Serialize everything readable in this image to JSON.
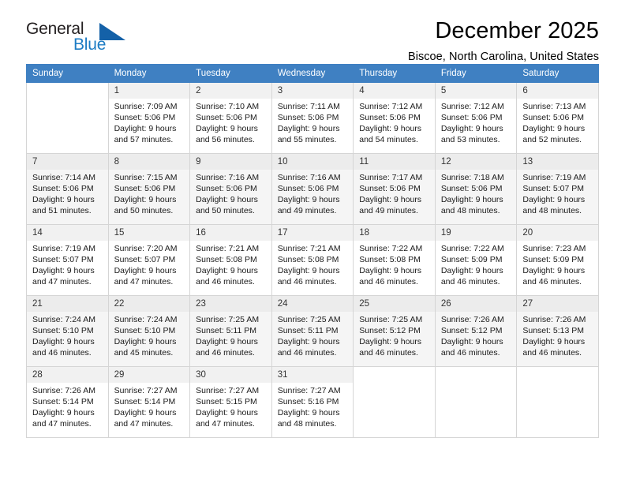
{
  "brand": {
    "name_part1": "General",
    "name_part2": "Blue",
    "triangle_color": "#1461a8",
    "blue_color": "#1d7cc4"
  },
  "header": {
    "title": "December 2025",
    "location": "Biscoe, North Carolina, United States"
  },
  "theme": {
    "header_row_bg": "#3f80c2",
    "header_row_text": "#ffffff",
    "grid_border": "#d5d5d5",
    "shaded_row_bg": "#f5f5f5",
    "daynum_bg": "#f1f1f1"
  },
  "weekdays": [
    "Sunday",
    "Monday",
    "Tuesday",
    "Wednesday",
    "Thursday",
    "Friday",
    "Saturday"
  ],
  "labels": {
    "sunrise_prefix": "Sunrise:",
    "sunset_prefix": "Sunset:",
    "daylight_prefix": "Daylight:"
  },
  "weeks": [
    {
      "shaded": false,
      "days": [
        {
          "num": "",
          "lines": []
        },
        {
          "num": "1",
          "lines": [
            "Sunrise: 7:09 AM",
            "Sunset: 5:06 PM",
            "Daylight: 9 hours",
            "and 57 minutes."
          ]
        },
        {
          "num": "2",
          "lines": [
            "Sunrise: 7:10 AM",
            "Sunset: 5:06 PM",
            "Daylight: 9 hours",
            "and 56 minutes."
          ]
        },
        {
          "num": "3",
          "lines": [
            "Sunrise: 7:11 AM",
            "Sunset: 5:06 PM",
            "Daylight: 9 hours",
            "and 55 minutes."
          ]
        },
        {
          "num": "4",
          "lines": [
            "Sunrise: 7:12 AM",
            "Sunset: 5:06 PM",
            "Daylight: 9 hours",
            "and 54 minutes."
          ]
        },
        {
          "num": "5",
          "lines": [
            "Sunrise: 7:12 AM",
            "Sunset: 5:06 PM",
            "Daylight: 9 hours",
            "and 53 minutes."
          ]
        },
        {
          "num": "6",
          "lines": [
            "Sunrise: 7:13 AM",
            "Sunset: 5:06 PM",
            "Daylight: 9 hours",
            "and 52 minutes."
          ]
        }
      ]
    },
    {
      "shaded": true,
      "days": [
        {
          "num": "7",
          "lines": [
            "Sunrise: 7:14 AM",
            "Sunset: 5:06 PM",
            "Daylight: 9 hours",
            "and 51 minutes."
          ]
        },
        {
          "num": "8",
          "lines": [
            "Sunrise: 7:15 AM",
            "Sunset: 5:06 PM",
            "Daylight: 9 hours",
            "and 50 minutes."
          ]
        },
        {
          "num": "9",
          "lines": [
            "Sunrise: 7:16 AM",
            "Sunset: 5:06 PM",
            "Daylight: 9 hours",
            "and 50 minutes."
          ]
        },
        {
          "num": "10",
          "lines": [
            "Sunrise: 7:16 AM",
            "Sunset: 5:06 PM",
            "Daylight: 9 hours",
            "and 49 minutes."
          ]
        },
        {
          "num": "11",
          "lines": [
            "Sunrise: 7:17 AM",
            "Sunset: 5:06 PM",
            "Daylight: 9 hours",
            "and 49 minutes."
          ]
        },
        {
          "num": "12",
          "lines": [
            "Sunrise: 7:18 AM",
            "Sunset: 5:06 PM",
            "Daylight: 9 hours",
            "and 48 minutes."
          ]
        },
        {
          "num": "13",
          "lines": [
            "Sunrise: 7:19 AM",
            "Sunset: 5:07 PM",
            "Daylight: 9 hours",
            "and 48 minutes."
          ]
        }
      ]
    },
    {
      "shaded": false,
      "days": [
        {
          "num": "14",
          "lines": [
            "Sunrise: 7:19 AM",
            "Sunset: 5:07 PM",
            "Daylight: 9 hours",
            "and 47 minutes."
          ]
        },
        {
          "num": "15",
          "lines": [
            "Sunrise: 7:20 AM",
            "Sunset: 5:07 PM",
            "Daylight: 9 hours",
            "and 47 minutes."
          ]
        },
        {
          "num": "16",
          "lines": [
            "Sunrise: 7:21 AM",
            "Sunset: 5:08 PM",
            "Daylight: 9 hours",
            "and 46 minutes."
          ]
        },
        {
          "num": "17",
          "lines": [
            "Sunrise: 7:21 AM",
            "Sunset: 5:08 PM",
            "Daylight: 9 hours",
            "and 46 minutes."
          ]
        },
        {
          "num": "18",
          "lines": [
            "Sunrise: 7:22 AM",
            "Sunset: 5:08 PM",
            "Daylight: 9 hours",
            "and 46 minutes."
          ]
        },
        {
          "num": "19",
          "lines": [
            "Sunrise: 7:22 AM",
            "Sunset: 5:09 PM",
            "Daylight: 9 hours",
            "and 46 minutes."
          ]
        },
        {
          "num": "20",
          "lines": [
            "Sunrise: 7:23 AM",
            "Sunset: 5:09 PM",
            "Daylight: 9 hours",
            "and 46 minutes."
          ]
        }
      ]
    },
    {
      "shaded": true,
      "days": [
        {
          "num": "21",
          "lines": [
            "Sunrise: 7:24 AM",
            "Sunset: 5:10 PM",
            "Daylight: 9 hours",
            "and 46 minutes."
          ]
        },
        {
          "num": "22",
          "lines": [
            "Sunrise: 7:24 AM",
            "Sunset: 5:10 PM",
            "Daylight: 9 hours",
            "and 45 minutes."
          ]
        },
        {
          "num": "23",
          "lines": [
            "Sunrise: 7:25 AM",
            "Sunset: 5:11 PM",
            "Daylight: 9 hours",
            "and 46 minutes."
          ]
        },
        {
          "num": "24",
          "lines": [
            "Sunrise: 7:25 AM",
            "Sunset: 5:11 PM",
            "Daylight: 9 hours",
            "and 46 minutes."
          ]
        },
        {
          "num": "25",
          "lines": [
            "Sunrise: 7:25 AM",
            "Sunset: 5:12 PM",
            "Daylight: 9 hours",
            "and 46 minutes."
          ]
        },
        {
          "num": "26",
          "lines": [
            "Sunrise: 7:26 AM",
            "Sunset: 5:12 PM",
            "Daylight: 9 hours",
            "and 46 minutes."
          ]
        },
        {
          "num": "27",
          "lines": [
            "Sunrise: 7:26 AM",
            "Sunset: 5:13 PM",
            "Daylight: 9 hours",
            "and 46 minutes."
          ]
        }
      ]
    },
    {
      "shaded": false,
      "days": [
        {
          "num": "28",
          "lines": [
            "Sunrise: 7:26 AM",
            "Sunset: 5:14 PM",
            "Daylight: 9 hours",
            "and 47 minutes."
          ]
        },
        {
          "num": "29",
          "lines": [
            "Sunrise: 7:27 AM",
            "Sunset: 5:14 PM",
            "Daylight: 9 hours",
            "and 47 minutes."
          ]
        },
        {
          "num": "30",
          "lines": [
            "Sunrise: 7:27 AM",
            "Sunset: 5:15 PM",
            "Daylight: 9 hours",
            "and 47 minutes."
          ]
        },
        {
          "num": "31",
          "lines": [
            "Sunrise: 7:27 AM",
            "Sunset: 5:16 PM",
            "Daylight: 9 hours",
            "and 48 minutes."
          ]
        },
        {
          "num": "",
          "lines": []
        },
        {
          "num": "",
          "lines": []
        },
        {
          "num": "",
          "lines": []
        }
      ]
    }
  ]
}
